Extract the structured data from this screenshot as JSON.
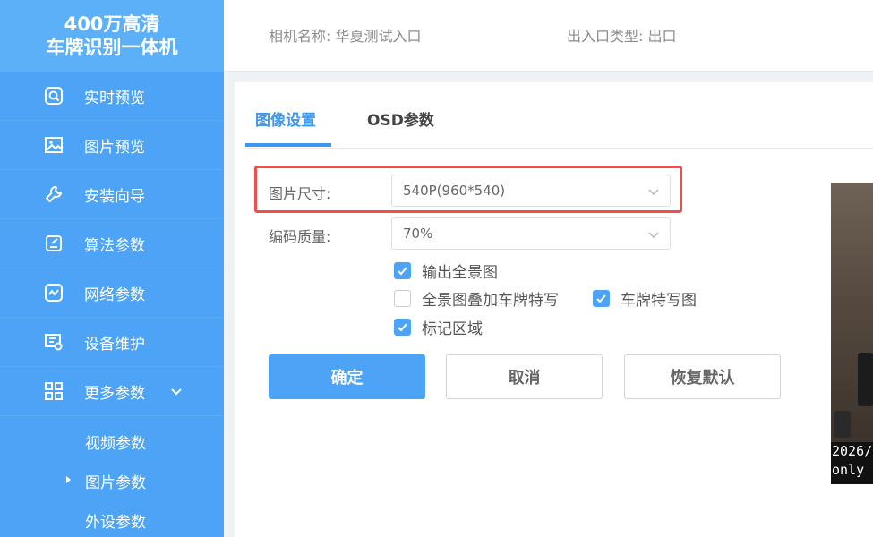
{
  "brand": {
    "line1": "400万高清",
    "line2": "车牌识别一体机"
  },
  "sidebar": {
    "items": [
      {
        "label": "实时预览",
        "icon": "live-view-icon"
      },
      {
        "label": "图片预览",
        "icon": "image-icon"
      },
      {
        "label": "安装向导",
        "icon": "wrench-icon"
      },
      {
        "label": "算法参数",
        "icon": "edit-document-icon"
      },
      {
        "label": "网络参数",
        "icon": "network-wave-icon"
      },
      {
        "label": "设备维护",
        "icon": "maintenance-icon"
      },
      {
        "label": "更多参数",
        "icon": "grid-icon"
      }
    ],
    "submenu": [
      {
        "label": "视频参数"
      },
      {
        "label": "图片参数",
        "active": true
      },
      {
        "label": "外设参数"
      }
    ]
  },
  "header": {
    "camera_name": "相机名称: 华夏测试入口",
    "entry_type": "出入口类型: 出口"
  },
  "tabs": [
    {
      "label": "图像设置",
      "active": true
    },
    {
      "label": "OSD参数",
      "active": false
    }
  ],
  "form": {
    "image_size_label": "图片尺寸:",
    "image_size_value": "540P(960*540)",
    "quality_label": "编码质量:",
    "quality_value": "70%",
    "checkboxes": [
      {
        "label": "输出全景图",
        "checked": true
      },
      {
        "label": "全景图叠加车牌特写",
        "checked": false
      },
      {
        "label": "车牌特写图",
        "checked": true
      },
      {
        "label": "标记区域",
        "checked": true
      }
    ]
  },
  "buttons": {
    "confirm": "确定",
    "cancel": "取消",
    "reset": "恢复默认"
  },
  "preview": {
    "osd_line1": "2026/",
    "osd_line2": "only"
  },
  "colors": {
    "accent": "#4da3f5",
    "highlight": "#f04d4d"
  }
}
